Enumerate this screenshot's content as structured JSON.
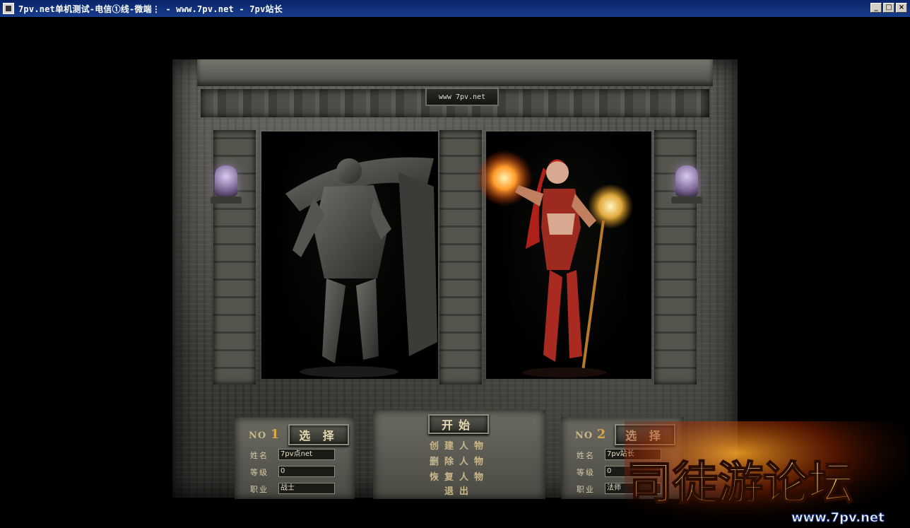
{
  "window": {
    "title": "7pv.net单机测试-电信①线-微端⋮ - www.7pv.net - 7pv站长",
    "controls": {
      "minimize": "_",
      "maximize": "□",
      "close": "×"
    }
  },
  "game": {
    "site_plate": "www 7pv.net",
    "slot1": {
      "no_label": "NO",
      "no_value": "1",
      "select_label": "选 择",
      "name_label": "姓名",
      "name_value": "7pv点net",
      "level_label": "等级",
      "level_value": "0",
      "class_label": "职业",
      "class_value": "战士"
    },
    "slot2": {
      "no_label": "NO",
      "no_value": "2",
      "select_label": "选 择",
      "name_label": "姓名",
      "name_value": "7pv站长",
      "level_label": "等级",
      "level_value": "0",
      "class_label": "职业",
      "class_value": "法师"
    },
    "menu": {
      "start": "开始",
      "create": "创建人物",
      "delete": "删除人物",
      "restore": "恢复人物",
      "exit": "退出"
    }
  },
  "watermark": {
    "text": "司徒游论坛",
    "url": "www.7pv.net"
  }
}
